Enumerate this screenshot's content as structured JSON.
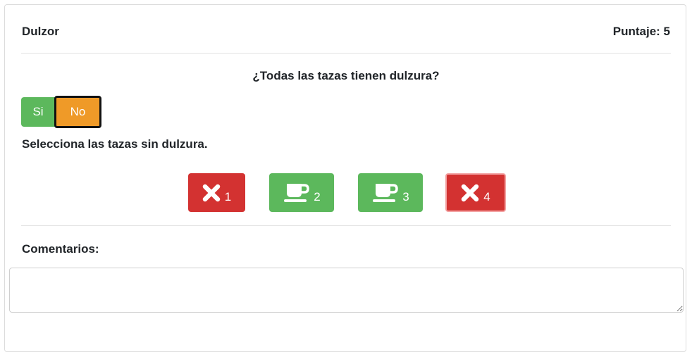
{
  "card": {
    "title": "Dulzor",
    "score_label": "Puntaje: 5"
  },
  "question": "¿Todas las tazas tienen dulzura?",
  "toggle": {
    "yes_label": "Si",
    "no_label": "No",
    "selected": "No"
  },
  "instruction": "Selecciona las tazas sin dulzura.",
  "cups": [
    {
      "number": "1",
      "icon": "x-icon",
      "state": "sin dulzura",
      "color": "#d33231"
    },
    {
      "number": "2",
      "icon": "coffee-cup-icon",
      "state": "con dulzura",
      "color": "#5cb85c"
    },
    {
      "number": "3",
      "icon": "coffee-cup-icon",
      "state": "con dulzura",
      "color": "#5cb85c"
    },
    {
      "number": "4",
      "icon": "x-icon",
      "state": "sin dulzura",
      "color": "#d33231"
    }
  ],
  "comments": {
    "label": "Comentarios:",
    "value": "",
    "placeholder": ""
  },
  "colors": {
    "success": "#5cb85c",
    "danger": "#d33231",
    "warning": "#ef9a28"
  }
}
